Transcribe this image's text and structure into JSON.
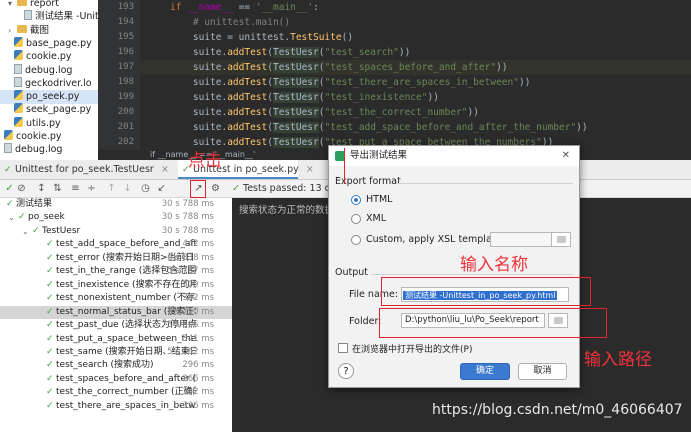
{
  "project_tree": {
    "items": [
      {
        "label": "report",
        "type": "folder",
        "indent": 8,
        "chev": "▾"
      },
      {
        "label": "测试结果 -Unit",
        "type": "file",
        "indent": 24,
        "chev": ""
      },
      {
        "label": "截图",
        "type": "folder",
        "indent": 8,
        "chev": "›"
      },
      {
        "label": "base_page.py",
        "type": "py",
        "indent": 14,
        "chev": ""
      },
      {
        "label": "cookie.py",
        "type": "py",
        "indent": 14,
        "chev": ""
      },
      {
        "label": "debug.log",
        "type": "file",
        "indent": 14,
        "chev": ""
      },
      {
        "label": "geckodriver.lo",
        "type": "file",
        "indent": 14,
        "chev": ""
      },
      {
        "label": "po_seek.py",
        "type": "py",
        "indent": 14,
        "chev": "",
        "selected": true
      },
      {
        "label": "seek_page.py",
        "type": "py",
        "indent": 14,
        "chev": ""
      },
      {
        "label": "utils.py",
        "type": "py",
        "indent": 14,
        "chev": ""
      },
      {
        "label": "cookie.py",
        "type": "py",
        "indent": 4,
        "chev": ""
      },
      {
        "label": "debug.log",
        "type": "file",
        "indent": 4,
        "chev": ""
      }
    ]
  },
  "editor": {
    "line_numbers": [
      "193",
      "194",
      "195",
      "196",
      "197",
      "198",
      "199",
      "200",
      "201",
      "202"
    ],
    "tests": [
      "test_search",
      "test_spaces_before_and_after",
      "test_there_are_spaces_in_between",
      "test_inexistence",
      "test_the_correct_number",
      "test_add_space_before_and_after_the_number",
      "test_put_a_space_between_the_numbers"
    ],
    "breadcrumb": "if __name__ == '__main__'"
  },
  "run_tabs": {
    "tab1": "Unittest for po_seek.TestUesr",
    "tab2": "Unittest in po_seek.py",
    "close": "×"
  },
  "toolbar": {
    "passed": "Tests passed: 13 of 1"
  },
  "test_tree": {
    "rows": [
      {
        "name": "测试结果",
        "time": "30 s 788 ms",
        "indent": 6,
        "chev": ""
      },
      {
        "name": "po_seek",
        "time": "30 s 788 ms",
        "indent": 18,
        "chev": "⌄"
      },
      {
        "name": "TestUesr",
        "time": "30 s 788 ms",
        "indent": 32,
        "chev": "⌄"
      },
      {
        "name": "test_add_space_before_and_after",
        "time": "442 ms",
        "indent": 46,
        "chev": ""
      },
      {
        "name": "test_error (搜索开始日期>当前日",
        "time": "6 s 838 ms",
        "indent": 46,
        "chev": ""
      },
      {
        "name": "test_in_the_range (选择包含范围!",
        "time": "5 s 787 ms",
        "indent": 46,
        "chev": ""
      },
      {
        "name": "test_inexistence (搜索不存在的用户",
        "time": "309 ms",
        "indent": 46,
        "chev": ""
      },
      {
        "name": "test_nonexistent_number (不存在的",
        "time": "382 ms",
        "indent": 46,
        "chev": ""
      },
      {
        "name": "test_normal_status_bar (搜索正常",
        "time": "3 s 790 ms",
        "indent": 46,
        "chev": "",
        "selected": true
      },
      {
        "name": "test_past_due (选择状态为停用点",
        "time": "5 s 806 ms",
        "indent": 46,
        "chev": ""
      },
      {
        "name": "test_put_a_space_between_the_nu",
        "time": "341 ms",
        "indent": 46,
        "chev": ""
      },
      {
        "name": "test_same (搜索开始日期、结束日",
        "time": "5 s 862 ms",
        "indent": 46,
        "chev": ""
      },
      {
        "name": "test_search (搜索成功)",
        "time": "296 ms",
        "indent": 46,
        "chev": ""
      },
      {
        "name": "test_spaces_before_and_after (搜索",
        "time": "266 ms",
        "indent": 46,
        "chev": ""
      },
      {
        "name": "test_the_correct_number (正确的手",
        "time": "332 ms",
        "indent": 46,
        "chev": ""
      },
      {
        "name": "test_there_are_spaces_in_between",
        "time": "336 ms",
        "indent": 46,
        "chev": ""
      }
    ]
  },
  "output": {
    "text": "搜索状态为正常的数据"
  },
  "dialog": {
    "title": "导出测试结果",
    "close": "✕",
    "export_format": "Export format",
    "html_option": "HTML",
    "xml_option": "XML",
    "custom_option": "Custom, apply XSL template:",
    "output_label": "Output",
    "file_name_label": "File name:",
    "file_name_value": "测试结果 -Unittest_in_po_seek_py.html",
    "folder_label": "Folder:",
    "folder_value": "D:\\python\\liu_lu\\Po_Seek\\report",
    "open_in_browser": "在浏览器中打开导出的文件(P)",
    "help": "?",
    "ok": "确定",
    "cancel": "取消"
  },
  "annotations": {
    "click": "点击",
    "enter_name": "输入名称",
    "enter_path": "输入路径",
    "color": "#e0242b"
  },
  "watermark": "https://blog.csdn.net/m0_46066407"
}
